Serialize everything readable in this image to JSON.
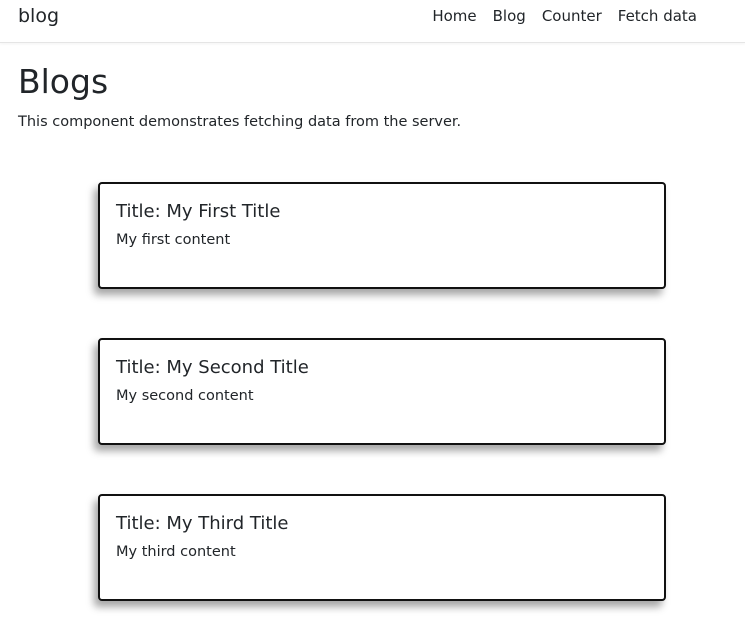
{
  "navbar": {
    "brand": "blog",
    "links": [
      "Home",
      "Blog",
      "Counter",
      "Fetch data"
    ]
  },
  "page": {
    "title": "Blogs",
    "subtitle": "This component demonstrates fetching data from the server."
  },
  "posts": [
    {
      "title": "Title: My First Title",
      "content": "My first content"
    },
    {
      "title": "Title: My Second Title",
      "content": "My second content"
    },
    {
      "title": "Title: My Third Title",
      "content": "My third content"
    }
  ]
}
